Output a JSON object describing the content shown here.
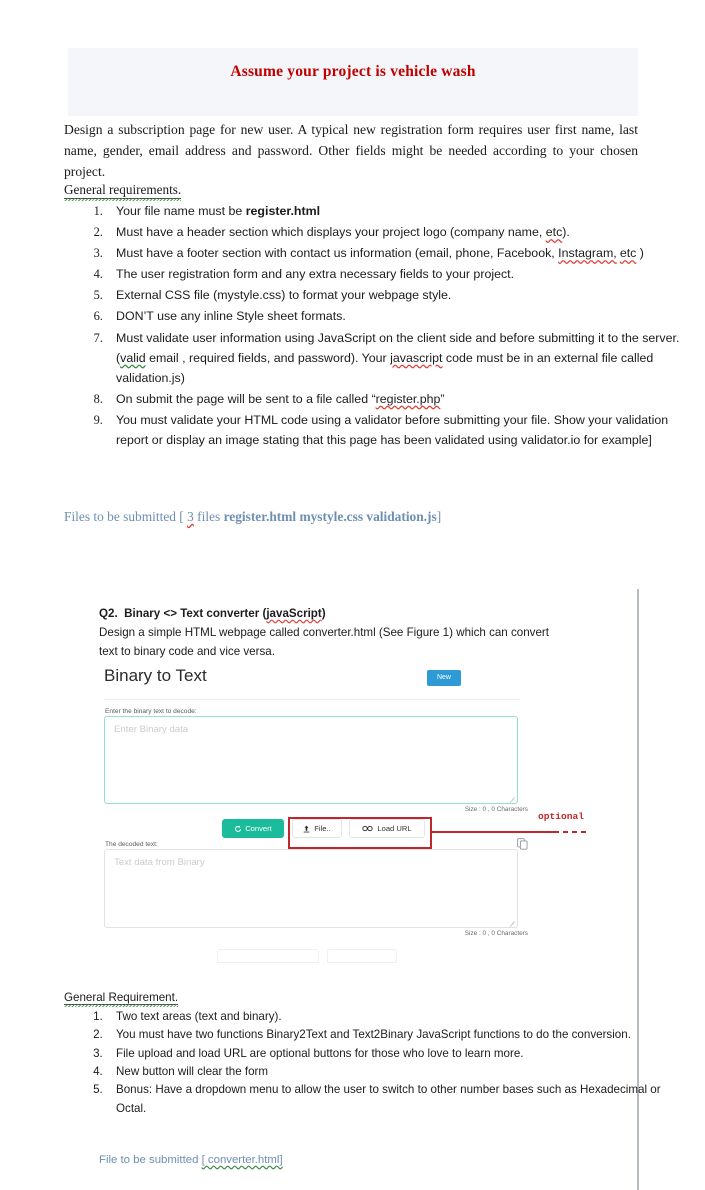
{
  "document": {
    "title": "Assume your project is vehicle wash",
    "title_color": "#c00000",
    "banner_bg": "#f4f6f9",
    "intro": "Design a subscription page for new user. A typical new registration form requires user first name, last name, gender, email address and password. Other fields might be needed according to your chosen project."
  },
  "q1": {
    "general_requirements_heading": "General requirements.",
    "items": [
      {
        "text_before": "Your file name must be ",
        "bold": "register.html",
        "text_after": ""
      },
      {
        "text_before": "Must have a header section which displays your project logo (company name, ",
        "squiggle": "etc",
        "text_after": ")."
      },
      {
        "text_before": " Must have a footer section with contact us information (email, phone, Facebook, ",
        "squiggle": "Instagram,",
        "squiggle2": "etc",
        "text_after": " )"
      },
      {
        "text_before": "The user registration form and any extra necessary fields to your project.",
        "text_after": ""
      },
      {
        "text_before": "External CSS file (mystyle.css) to format your webpage style.",
        "text_after": ""
      },
      {
        "text_before": "DON’T use any inline Style sheet formats.",
        "text_after": ""
      },
      {
        "text_before": "Must validate user information using JavaScript on the client side and before submitting it to the server. (",
        "squiggle": "valid",
        "mid": " email , required fields, and password). Your ",
        "squiggle2": "javascript",
        "text_after": " code must be in an external file called validation.js)"
      },
      {
        "text_before": "On submit the page will be sent to a file called “",
        "squiggle": "register.php",
        "text_after": "”"
      },
      {
        "text_before": "You must validate your HTML code using a validator before submitting your file. Show your validation report or display an image stating that this page has been validated using validator.io for example]",
        "text_after": ""
      }
    ],
    "files_label": "Files to be submitted [ ",
    "files_count": "3",
    "files_mid": " files ",
    "files_bold": "register.html  mystyle.css  validation.js",
    "files_close": "]",
    "files_color": "#6e8eb3"
  },
  "q2": {
    "heading_prefix": "Q2.",
    "heading_main": "Binary <> Text converter (",
    "heading_squiggle": "javaScript",
    "heading_suffix": ")",
    "description": "Design a simple HTML webpage called converter.html (See Figure 1) which can convert text to binary code and vice versa.",
    "general_requirement_heading": "General Requirement.",
    "items": [
      "Two text areas (text and binary).",
      "You must have two functions Binary2Text and Text2Binary JavaScript functions to do the conversion.",
      "File upload and load URL are optional buttons for those who love to learn more.",
      "New button will clear the form",
      "Bonus: Have a dropdown menu to allow the user to switch to other number bases such as Hexadecimal or Octal."
    ],
    "file_label": "File to be submitted ",
    "file_squiggle": "[ converter.html]"
  },
  "figure": {
    "title": "Binary to Text",
    "new_button": "New",
    "new_button_color": "#2e9bd6",
    "input_label": "Enter the binary text to decode:",
    "input_placeholder": "Enter Binary data",
    "input_border_color": "#97e0cf",
    "input_size": "Size : 0 , 0 Characters",
    "convert_button": "Convert",
    "convert_icon": "refresh-icon",
    "convert_color": "#1abc9c",
    "file_button": "File..",
    "file_icon": "upload-icon",
    "loadurl_button": "Load URL",
    "loadurl_icon": "link-icon",
    "output_label": "The decoded text:",
    "output_placeholder": "Text data from Binary",
    "output_border_color": "#dfe3e6",
    "output_size": "Size : 0 , 0 Characters",
    "copy_icon": "copy-icon"
  },
  "annotation": {
    "text": "optional",
    "color": "#c0272d"
  }
}
